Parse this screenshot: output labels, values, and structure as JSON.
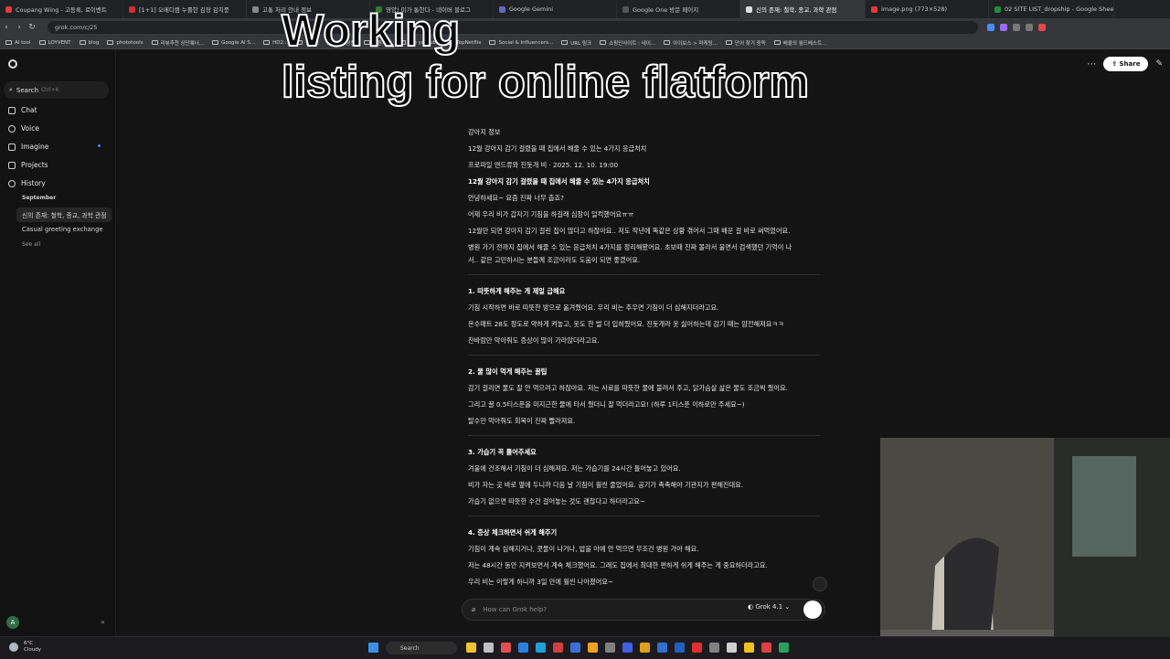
{
  "browser": {
    "tabs": [
      {
        "label": "Coupang Wing - 고등록, 로이벤트",
        "color": "#e53935"
      },
      {
        "label": "[1+1] 오메디캠 누롤한 김장 감치풍",
        "color": "#d32f2f"
      },
      {
        "label": "고통 처리 안내 정보",
        "color": "#888888"
      },
      {
        "label": "영양! 미가 통한다 - 네이버 블로그",
        "color": "#2e7d32"
      },
      {
        "label": "Google Gemini",
        "color": "#5c6bc0"
      },
      {
        "label": "Google One 방문 페이지",
        "color": "#555555"
      },
      {
        "label": "신의 존재: 철학, 종교, 과학 관점",
        "color": "#dddddd"
      },
      {
        "label": "image.png (773×528)",
        "color": "#e53935"
      },
      {
        "label": "02 SITE LIST_dropship - Google Sheets",
        "color": "#1e8e3e"
      }
    ],
    "url": "grok.com/c/25",
    "bookmarks": [
      "AI tool",
      "LOYVENT",
      "blog",
      "phototools",
      "리뷰추천 상단웨너...",
      "Google AI S...",
      "HD2...",
      "한자포",
      "참고상품",
      "창원지원",
      "top youtube",
      "TopNetflix",
      "Social & Influencers...",
      "URL 링크",
      "쇼핑인사이트 : 네이...",
      "아이보스 > 마케팅...",
      "단어 찾기 중독",
      "배율의 월드베스트..."
    ]
  },
  "overlay": {
    "line1": "Working",
    "line2": "listing for online flatform"
  },
  "sidebar": {
    "search_label": "Search",
    "search_hint": "Ctrl+K",
    "nav": [
      "Chat",
      "Voice",
      "Imagine",
      "Projects",
      "History"
    ],
    "history_group": "September",
    "history_items": [
      "신의 존재: 철학, 종교, 과학 관점",
      "Casual greeting exchange"
    ],
    "see_all": "See all",
    "avatar": "A"
  },
  "header": {
    "share_label": "Share"
  },
  "article": {
    "lines": [
      {
        "text": "강아지 정보",
        "bold": false
      },
      {
        "text": "12월 강아지 감기 걸렸을 때 집에서 해줄 수 있는 4가지 응급처치",
        "bold": false
      },
      {
        "text": "프로파일 앤드류와 진돗개 비 · 2025. 12. 10. 19:00",
        "bold": false
      },
      {
        "text": "12월 강아지 감기 걸렸을 때 집에서 해줄 수 있는 4가지 응급처치",
        "bold": true
      },
      {
        "text": "안녕하세요~ 요즘 진짜 너무 춥죠?",
        "bold": false
      },
      {
        "text": "어제 우리 비가 갑자기 기침을 하길래 심장이 덜컥했어요ㅠㅠ",
        "bold": false
      },
      {
        "text": "12월만 되면 강아지 감기 걸린 집이 많다고 하잖아요.. 저도 작년에 똑같은 상황 겪어서 그때 배운 걸 바로 써먹었어요.",
        "bold": false
      },
      {
        "text": "병원 가기 전까지 집에서 해줄 수 있는 응급처치 4가지를 정리해봤어요. 초보때 진짜 몰라서 울면서 검색했던 기억이 나",
        "bold": false
      },
      {
        "text": "서.. 같은 고민하시는 분들께 조금이라도 도움이 되면 좋겠어요.",
        "bold": false
      },
      {
        "text": "1. 따뜻하게 해주는 게 제일 급해요",
        "bold": true
      },
      {
        "text": "기침 시작하면 바로 따뜻한 방으로 옮겨줬어요. 우리 비는 추우면 기침이 더 심해지더라고요.",
        "bold": false
      },
      {
        "text": "온수매트 28도 정도로 약하게 켜놓고, 옷도 한 벌 더 입혀줬어요. 진돗개라 옷 싫어하는데 감기 때는 얌전해져요ㅋㅋ",
        "bold": false
      },
      {
        "text": "찬바람만 막아줘도 증상이 많이 가라앉더라고요.",
        "bold": false
      },
      {
        "text": "2. 물 많이 먹게 해주는 꿀팁",
        "bold": true
      },
      {
        "text": "감기 걸리면 물도 잘 안 먹으려고 하잖아요. 저는 사료를 따뜻한 물에 불려서 주고, 닭가슴살 삶은 물도 조금씩 줬어요.",
        "bold": false
      },
      {
        "text": "그리고 꿀 0.5티스푼을 미지근한 물에 타서 줬더니 잘 먹더라고요! (하루 1티스푼 이하로만 주세요~)",
        "bold": false
      },
      {
        "text": "탈수만 막아줘도 회복이 진짜 빨라져요.",
        "bold": false
      },
      {
        "text": "3. 가습기 꼭 틀어주세요",
        "bold": true
      },
      {
        "text": "겨울에 건조해서 기침이 더 심해져요. 저는 가습기를 24시간 틀어놓고 있어요.",
        "bold": false
      },
      {
        "text": "비가 자는 곳 바로 옆에 두니까 다음 날 기침이 훨씬 줄었어요. 공기가 촉촉해야 기관지가 편해진대요.",
        "bold": false
      },
      {
        "text": "가습기 없으면 따뜻한 수건 걸어놓는 것도 괜찮다고 하더라고요~",
        "bold": false
      },
      {
        "text": "4. 증상 체크하면서 쉬게 해주기",
        "bold": true
      },
      {
        "text": "기침이 계속 심해지거나, 콧물이 나거나, 밥을 아예 안 먹으면 무조건 병원 가야 해요.",
        "bold": false
      },
      {
        "text": "저는 48시간 동안 지켜보면서 계속 체크했어요. 그래도 집에서 최대한 편하게 쉬게 해주는 게 중요하더라고요.",
        "bold": false
      },
      {
        "text": "우리 비는 이렇게 하니까 3일 만에 훨씬 나아졌어요~",
        "bold": false
      }
    ]
  },
  "composer": {
    "placeholder": "How can Grok help?",
    "model": "Grok 4.1"
  },
  "taskbar": {
    "temp": "6°C",
    "condition": "Cloudy",
    "search": "Search"
  }
}
